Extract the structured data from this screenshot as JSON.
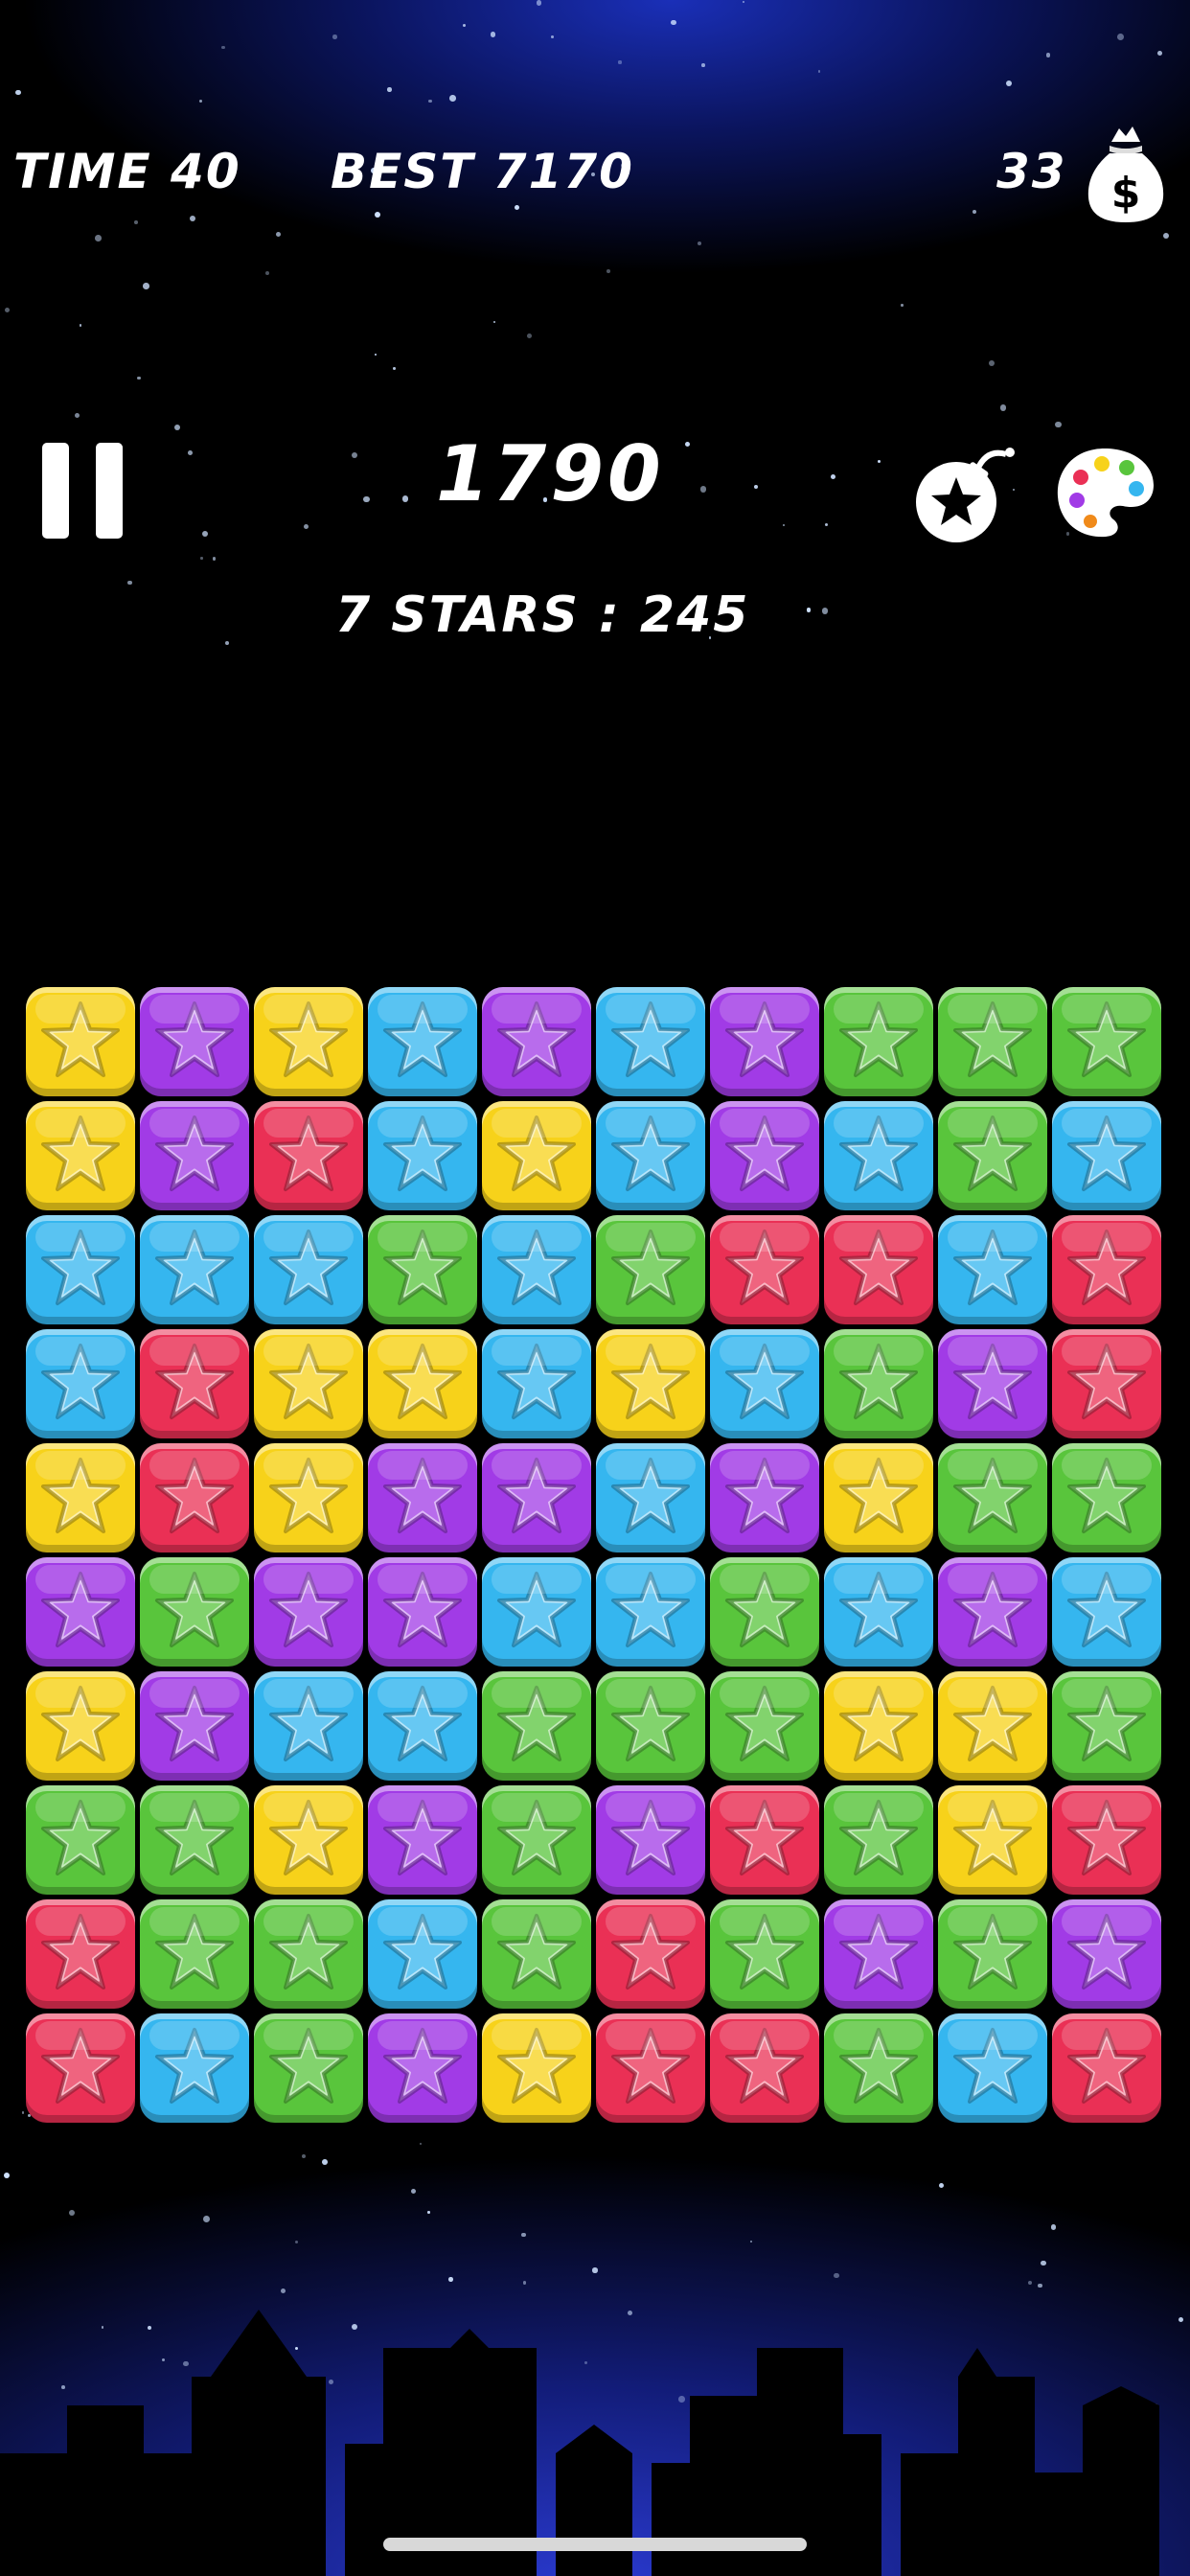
{
  "hud": {
    "time_label": "TIME 40",
    "best_label": "BEST 7170",
    "money_count": "33",
    "score": "1790",
    "stars_info": "7 STARS : 245"
  },
  "icons": {
    "pause": "pause-icon",
    "money": "money-bag-icon",
    "bomb": "star-bomb-icon",
    "palette": "color-palette-icon"
  },
  "colors": {
    "yellow": "#f7d21a",
    "purple": "#a13be6",
    "red": "#ea3055",
    "blue": "#35b6ef",
    "green": "#59c53c"
  },
  "board": [
    [
      "yellow",
      "purple",
      "yellow",
      "blue",
      "purple",
      "blue",
      "purple",
      "green",
      "green",
      "green"
    ],
    [
      "yellow",
      "purple",
      "red",
      "blue",
      "yellow",
      "blue",
      "purple",
      "blue",
      "green",
      "blue"
    ],
    [
      "blue",
      "blue",
      "blue",
      "green",
      "blue",
      "green",
      "red",
      "red",
      "blue",
      "red"
    ],
    [
      "blue",
      "red",
      "yellow",
      "yellow",
      "blue",
      "yellow",
      "blue",
      "green",
      "purple",
      "red"
    ],
    [
      "yellow",
      "red",
      "yellow",
      "purple",
      "purple",
      "blue",
      "purple",
      "yellow",
      "green",
      "green"
    ],
    [
      "purple",
      "green",
      "purple",
      "purple",
      "blue",
      "blue",
      "green",
      "blue",
      "purple",
      "blue"
    ],
    [
      "yellow",
      "purple",
      "blue",
      "blue",
      "green",
      "green",
      "green",
      "yellow",
      "yellow",
      "green"
    ],
    [
      "green",
      "green",
      "yellow",
      "purple",
      "green",
      "purple",
      "red",
      "green",
      "yellow",
      "red"
    ],
    [
      "red",
      "green",
      "green",
      "blue",
      "green",
      "red",
      "green",
      "purple",
      "green",
      "purple"
    ],
    [
      "red",
      "blue",
      "green",
      "purple",
      "yellow",
      "red",
      "red",
      "green",
      "blue",
      "red"
    ]
  ]
}
